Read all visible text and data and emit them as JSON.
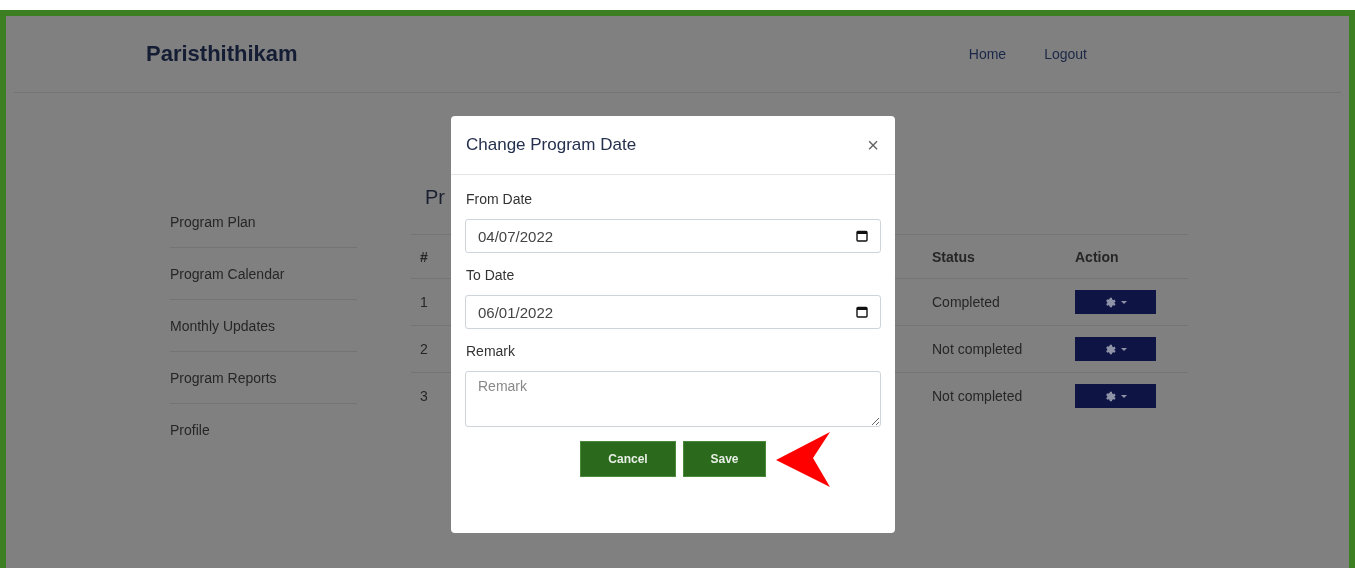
{
  "header": {
    "brand": "Paristhithikam",
    "nav": [
      {
        "label": "Home"
      },
      {
        "label": "Logout"
      }
    ]
  },
  "sidebar": {
    "items": [
      {
        "label": "Program Plan"
      },
      {
        "label": "Program Calendar"
      },
      {
        "label": "Monthly Updates"
      },
      {
        "label": "Program Reports"
      },
      {
        "label": "Profile"
      }
    ]
  },
  "content": {
    "heading": "Pr",
    "table": {
      "columns": [
        "#",
        "Status",
        "Action"
      ],
      "rows": [
        {
          "index": "1",
          "status": "Completed"
        },
        {
          "index": "2",
          "status": "Not completed"
        },
        {
          "index": "3",
          "status": "Not completed"
        }
      ]
    }
  },
  "modal": {
    "title": "Change Program Date",
    "close": "×",
    "fields": [
      {
        "kind": "date",
        "label": "From Date",
        "value": "04/07/2022"
      },
      {
        "kind": "date",
        "label": "To Date",
        "value": "06/01/2022"
      },
      {
        "kind": "textarea",
        "label": "Remark",
        "placeholder": "Remark"
      }
    ],
    "buttons": [
      "Cancel",
      "Save"
    ]
  }
}
